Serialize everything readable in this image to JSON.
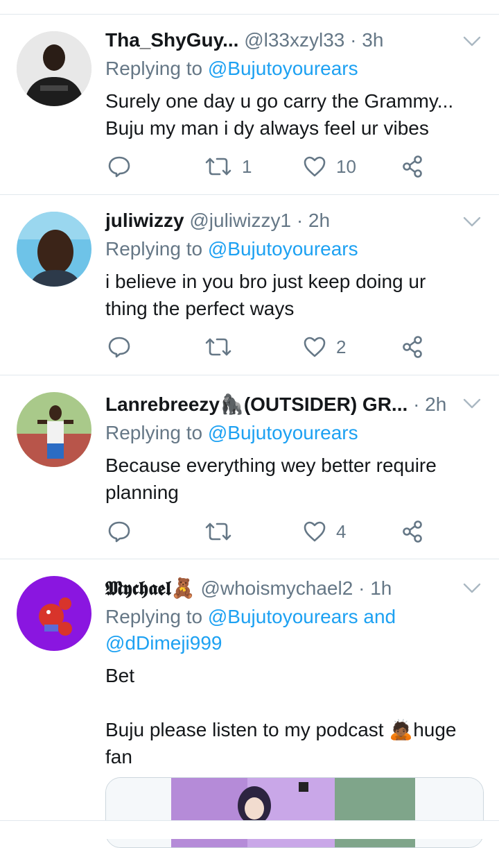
{
  "tweets": [
    {
      "name": "Tha_ShyGuy...",
      "handle": "@l33xzyl33",
      "time": "3h",
      "reply_prefix": "Replying to",
      "reply_to": "@Bujutoyourears",
      "text_lines": [
        "Surely one day u go carry the Grammy...",
        "Buju my man i dy always feel ur vibes"
      ],
      "retweets": "1",
      "likes": "10"
    },
    {
      "name": "juliwizzy",
      "handle": "@juliwizzy1",
      "time": "2h",
      "reply_prefix": "Replying to",
      "reply_to": "@Bujutoyourears",
      "text_lines": [
        "i believe in you bro just keep doing ur",
        "thing the perfect ways"
      ],
      "retweets": "",
      "likes": "2"
    },
    {
      "name": "Lanrebreezy🦍(OUTSIDER) GR...",
      "handle": "",
      "time": "2h",
      "reply_prefix": "Replying to",
      "reply_to": "@Bujutoyourears",
      "text_lines": [
        "Because everything wey better require",
        "planning"
      ],
      "retweets": "",
      "likes": "4"
    },
    {
      "name": "𝕸𝖞𝖈𝖍𝖆𝖊𝖑🧸",
      "handle": "@whoismychael2",
      "time": "1h",
      "reply_prefix": "Replying to",
      "reply_to": "@Bujutoyourears and",
      "reply_to_2": "@dDimeji999",
      "text_lines": [
        "Bet",
        "Buju please listen to my podcast 🙇🏾huge",
        "fan"
      ]
    }
  ],
  "colors": {
    "accent": "#1da1f2",
    "muted": "#657786",
    "text": "#14171a",
    "divider": "#e1e8ed"
  },
  "icons": [
    "chevron-down-icon",
    "reply-icon",
    "retweet-icon",
    "like-icon",
    "share-icon"
  ]
}
